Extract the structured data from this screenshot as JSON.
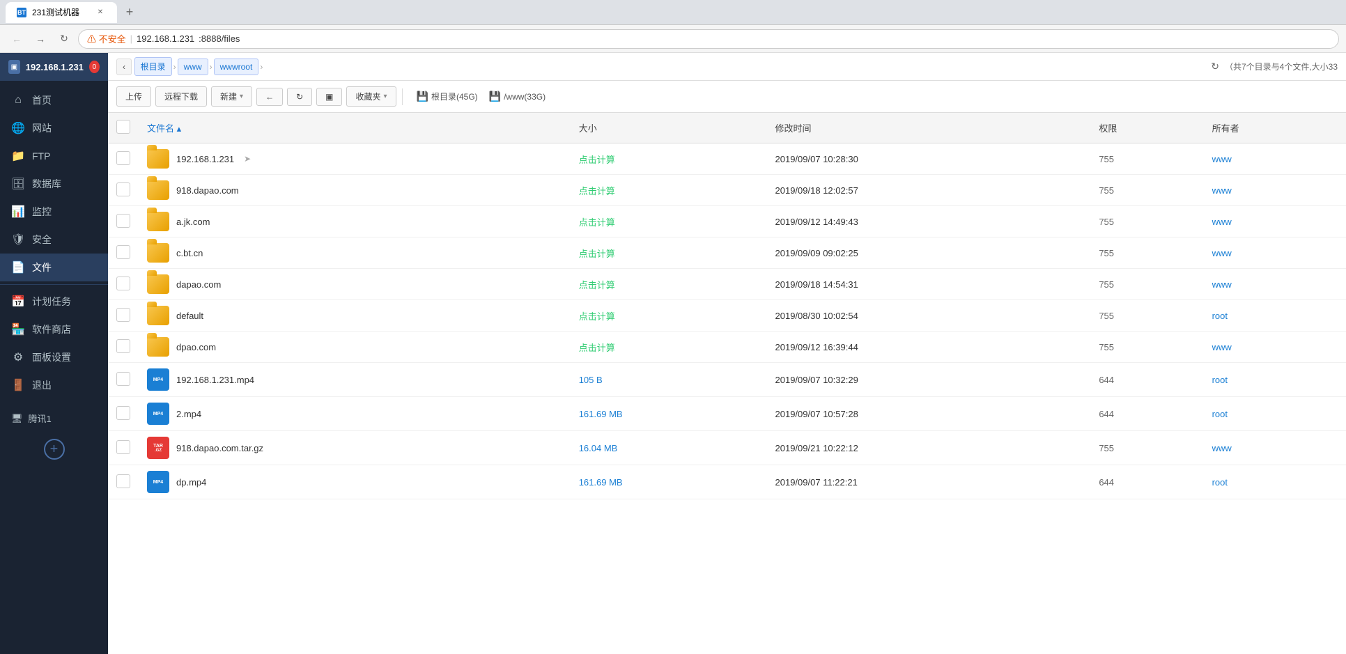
{
  "browser": {
    "tab_title": "231测试机器",
    "favicon_text": "BT",
    "address_warning": "⚠ 不安全",
    "address_url": "192.168.1.231:8888/files",
    "address_host": "192.168.1.231",
    "address_port_path": ":8888/files"
  },
  "sidebar": {
    "server_ip": "192.168.1.231",
    "badge_count": "0",
    "items": [
      {
        "id": "home",
        "icon": "⌂",
        "label": "首页"
      },
      {
        "id": "website",
        "icon": "🌐",
        "label": "网站"
      },
      {
        "id": "ftp",
        "icon": "📁",
        "label": "FTP"
      },
      {
        "id": "database",
        "icon": "🗄",
        "label": "数据库"
      },
      {
        "id": "monitor",
        "icon": "📊",
        "label": "监控"
      },
      {
        "id": "security",
        "icon": "🛡",
        "label": "安全"
      },
      {
        "id": "files",
        "icon": "📄",
        "label": "文件",
        "active": true
      },
      {
        "id": "scheduled",
        "icon": "📅",
        "label": "计划任务"
      },
      {
        "id": "appstore",
        "icon": "🏪",
        "label": "软件商店"
      },
      {
        "id": "settings",
        "icon": "⚙",
        "label": "面板设置"
      },
      {
        "id": "logout",
        "icon": "🚪",
        "label": "退出"
      }
    ],
    "account_name": "腾讯1"
  },
  "filemanager": {
    "breadcrumb_back": "‹",
    "breadcrumb_items": [
      "根目录",
      "www",
      "wwwroot"
    ],
    "refresh_icon": "↻",
    "summary": "（共7个目录与4个文件,大小33",
    "toolbar": {
      "upload": "上传",
      "remote_download": "远程下载",
      "new": "新建",
      "back": "←",
      "refresh": "↻",
      "terminal": "▣",
      "bookmark": "收藏夹"
    },
    "disks": [
      {
        "label": "根目录(45G)"
      },
      {
        "label": "/www(33G)"
      }
    ],
    "columns": {
      "checkbox": "",
      "name": "文件名",
      "size": "大小",
      "modified": "修改时间",
      "permissions": "权限",
      "owner": "所有者"
    },
    "files": [
      {
        "type": "folder",
        "name": "192.168.1.231",
        "size_display": "点击计算",
        "modified": "2019/09/07 10:28:30",
        "permissions": "755",
        "owner": "www"
      },
      {
        "type": "folder",
        "name": "918.dapao.com",
        "size_display": "点击计算",
        "modified": "2019/09/18 12:02:57",
        "permissions": "755",
        "owner": "www"
      },
      {
        "type": "folder",
        "name": "a.jk.com",
        "size_display": "点击计算",
        "modified": "2019/09/12 14:49:43",
        "permissions": "755",
        "owner": "www"
      },
      {
        "type": "folder",
        "name": "c.bt.cn",
        "size_display": "点击计算",
        "modified": "2019/09/09 09:02:25",
        "permissions": "755",
        "owner": "www"
      },
      {
        "type": "folder",
        "name": "dapao.com",
        "size_display": "点击计算",
        "modified": "2019/09/18 14:54:31",
        "permissions": "755",
        "owner": "www"
      },
      {
        "type": "folder",
        "name": "default",
        "size_display": "点击计算",
        "modified": "2019/08/30 10:02:54",
        "permissions": "755",
        "owner": "root"
      },
      {
        "type": "folder",
        "name": "dpao.com",
        "size_display": "点击计算",
        "modified": "2019/09/12 16:39:44",
        "permissions": "755",
        "owner": "www"
      },
      {
        "type": "mp4",
        "name": "192.168.1.231.mp4",
        "size_display": "105 B",
        "modified": "2019/09/07 10:32:29",
        "permissions": "644",
        "owner": "root"
      },
      {
        "type": "mp4",
        "name": "2.mp4",
        "size_display": "161.69 MB",
        "modified": "2019/09/07 10:57:28",
        "permissions": "644",
        "owner": "root"
      },
      {
        "type": "targz",
        "name": "918.dapao.com.tar.gz",
        "size_display": "16.04 MB",
        "modified": "2019/09/21 10:22:12",
        "permissions": "755",
        "owner": "www"
      },
      {
        "type": "mp4",
        "name": "dp.mp4",
        "size_display": "161.69 MB",
        "modified": "2019/09/07 11:22:21",
        "permissions": "644",
        "owner": "root"
      }
    ]
  }
}
